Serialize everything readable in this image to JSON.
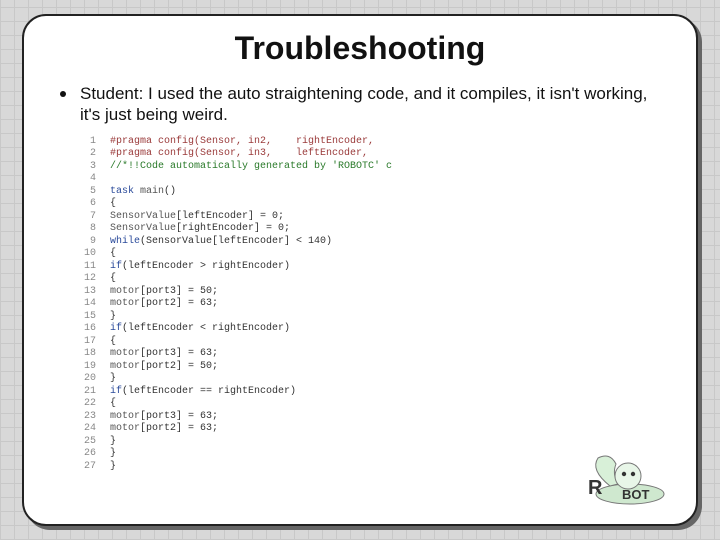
{
  "title": "Troubleshooting",
  "bullet": "Student: I used the auto straightening code, and it compiles, it isn't working, it's just being weird.",
  "code": {
    "lines": [
      {
        "n": "1",
        "seg": [
          {
            "cls": "c-pragma",
            "t": "#pragma config(Sensor, in2,    rightEncoder,"
          }
        ]
      },
      {
        "n": "2",
        "seg": [
          {
            "cls": "c-pragma",
            "t": "#pragma config(Sensor, in3,    leftEncoder,"
          }
        ]
      },
      {
        "n": "3",
        "seg": [
          {
            "cls": "c-comment",
            "t": "//*!!Code automatically generated by 'ROBOTC' c"
          }
        ]
      },
      {
        "n": "4",
        "seg": [
          {
            "cls": "c-plain",
            "t": ""
          }
        ]
      },
      {
        "n": "5",
        "seg": [
          {
            "cls": "c-kw",
            "t": "task "
          },
          {
            "cls": "c-id",
            "t": "main"
          },
          {
            "cls": "c-plain",
            "t": "()"
          }
        ]
      },
      {
        "n": "6",
        "seg": [
          {
            "cls": "c-plain",
            "t": "{"
          }
        ]
      },
      {
        "n": "7",
        "seg": [
          {
            "cls": "c-id",
            "t": "SensorValue"
          },
          {
            "cls": "c-plain",
            "t": "[leftEncoder] = 0;"
          }
        ]
      },
      {
        "n": "8",
        "seg": [
          {
            "cls": "c-id",
            "t": "SensorValue"
          },
          {
            "cls": "c-plain",
            "t": "[rightEncoder] = 0;"
          }
        ]
      },
      {
        "n": "9",
        "seg": [
          {
            "cls": "c-kw",
            "t": "while"
          },
          {
            "cls": "c-plain",
            "t": "(SensorValue[leftEncoder] < 140)"
          }
        ]
      },
      {
        "n": "10",
        "seg": [
          {
            "cls": "c-plain",
            "t": "{"
          }
        ]
      },
      {
        "n": "11",
        "seg": [
          {
            "cls": "c-kw",
            "t": "if"
          },
          {
            "cls": "c-plain",
            "t": "(leftEncoder > rightEncoder)"
          }
        ]
      },
      {
        "n": "12",
        "seg": [
          {
            "cls": "c-plain",
            "t": "{"
          }
        ]
      },
      {
        "n": "13",
        "seg": [
          {
            "cls": "c-id",
            "t": "motor"
          },
          {
            "cls": "c-plain",
            "t": "[port3] = 50;"
          }
        ]
      },
      {
        "n": "14",
        "seg": [
          {
            "cls": "c-id",
            "t": "motor"
          },
          {
            "cls": "c-plain",
            "t": "[port2] = 63;"
          }
        ]
      },
      {
        "n": "15",
        "seg": [
          {
            "cls": "c-plain",
            "t": "}"
          }
        ]
      },
      {
        "n": "16",
        "seg": [
          {
            "cls": "c-kw",
            "t": "if"
          },
          {
            "cls": "c-plain",
            "t": "(leftEncoder < rightEncoder)"
          }
        ]
      },
      {
        "n": "17",
        "seg": [
          {
            "cls": "c-plain",
            "t": "{"
          }
        ]
      },
      {
        "n": "18",
        "seg": [
          {
            "cls": "c-id",
            "t": "motor"
          },
          {
            "cls": "c-plain",
            "t": "[port3] = 63;"
          }
        ]
      },
      {
        "n": "19",
        "seg": [
          {
            "cls": "c-id",
            "t": "motor"
          },
          {
            "cls": "c-plain",
            "t": "[port2] = 50;"
          }
        ]
      },
      {
        "n": "20",
        "seg": [
          {
            "cls": "c-plain",
            "t": "}"
          }
        ]
      },
      {
        "n": "21",
        "seg": [
          {
            "cls": "c-kw",
            "t": "if"
          },
          {
            "cls": "c-plain",
            "t": "(leftEncoder == rightEncoder)"
          }
        ]
      },
      {
        "n": "22",
        "seg": [
          {
            "cls": "c-plain",
            "t": "{"
          }
        ]
      },
      {
        "n": "23",
        "seg": [
          {
            "cls": "c-id",
            "t": "motor"
          },
          {
            "cls": "c-plain",
            "t": "[port3] = 63;"
          }
        ]
      },
      {
        "n": "24",
        "seg": [
          {
            "cls": "c-id",
            "t": "motor"
          },
          {
            "cls": "c-plain",
            "t": "[port2] = 63;"
          }
        ]
      },
      {
        "n": "25",
        "seg": [
          {
            "cls": "c-plain",
            "t": "}"
          }
        ]
      },
      {
        "n": "26",
        "seg": [
          {
            "cls": "c-plain",
            "t": "}"
          }
        ]
      },
      {
        "n": "27",
        "seg": [
          {
            "cls": "c-plain",
            "t": "}"
          }
        ]
      }
    ]
  },
  "logo": {
    "text_r": "R",
    "text_bot": "BOT"
  }
}
